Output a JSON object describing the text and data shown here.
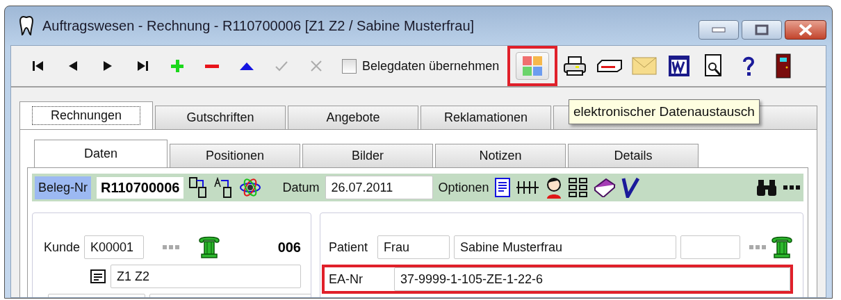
{
  "window": {
    "title": "Auftragswesen - Rechnung - R110700006 [Z1 Z2 / Sabine Musterfrau]"
  },
  "toolbar": {
    "nav": [
      {
        "kind": "first",
        "disabled": false
      },
      {
        "kind": "prev",
        "disabled": false
      },
      {
        "kind": "next",
        "disabled": false
      },
      {
        "kind": "last",
        "disabled": false
      },
      {
        "kind": "add",
        "disabled": false
      },
      {
        "kind": "remove",
        "disabled": false
      },
      {
        "kind": "up",
        "disabled": false
      },
      {
        "kind": "confirm",
        "disabled": true
      },
      {
        "kind": "cancel",
        "disabled": true
      }
    ],
    "checkbox": {
      "label": "Belegdaten übernehmen",
      "checked": false
    },
    "actions": [
      {
        "kind": "exchange",
        "highlighted": true
      },
      {
        "kind": "print",
        "highlighted": false
      },
      {
        "kind": "card",
        "highlighted": false
      },
      {
        "kind": "mail",
        "highlighted": false
      },
      {
        "kind": "word",
        "highlighted": false
      },
      {
        "kind": "preview",
        "highlighted": false
      },
      {
        "kind": "help",
        "highlighted": false
      },
      {
        "kind": "exit",
        "highlighted": false
      }
    ]
  },
  "tooltip": "elektronischer Datenaustausch",
  "tabs": [
    {
      "label": "Rechnungen",
      "selected": true
    },
    {
      "label": "Gutschriften",
      "selected": false
    },
    {
      "label": "Angebote",
      "selected": false
    },
    {
      "label": "Reklamationen",
      "selected": false
    },
    {
      "selected": false
    }
  ],
  "subtabs": [
    {
      "label": "Daten",
      "selected": true
    },
    {
      "label": "Positionen",
      "selected": false
    },
    {
      "label": "Bilder",
      "selected": false
    },
    {
      "label": "Notizen",
      "selected": false
    },
    {
      "label": "Details",
      "selected": false
    }
  ],
  "header": {
    "number_label": "Beleg-Nr",
    "number": "R110700006",
    "date_label": "Datum",
    "date": "26.07.2011",
    "options_label": "Optionen"
  },
  "customer": {
    "label": "Kunde",
    "id": "K00001",
    "count": "006",
    "note": "Z1 Z2"
  },
  "patient": {
    "label": "Patient",
    "salutation": "Frau",
    "name": "Sabine Musterfrau",
    "ea_label": "EA-Nr",
    "ea_number": "37-9999-1-105-ZE-1-22-6",
    "ea_highlighted": true
  }
}
